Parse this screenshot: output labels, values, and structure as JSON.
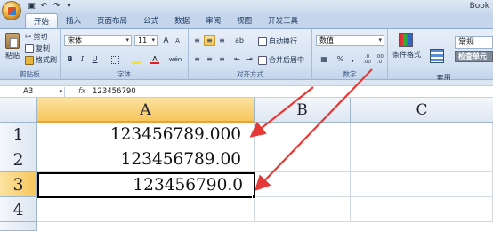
{
  "title_bar": {
    "title": "Book",
    "qat_icons": [
      "save-icon",
      "undo-icon",
      "redo-icon",
      "customize-icon"
    ]
  },
  "tabs": [
    {
      "label": "开始",
      "active": true
    },
    {
      "label": "插入"
    },
    {
      "label": "页面布局"
    },
    {
      "label": "公式"
    },
    {
      "label": "数据"
    },
    {
      "label": "审阅"
    },
    {
      "label": "视图"
    },
    {
      "label": "开发工具"
    }
  ],
  "clipboard": {
    "paste": "粘贴",
    "cut": "剪切",
    "copy": "复制",
    "format_painter": "格式刷",
    "label": "剪贴板"
  },
  "font": {
    "name": "宋体",
    "size": "11",
    "label": "字体",
    "bold": "B",
    "italic": "I",
    "underline": "U",
    "grow": "A",
    "shrink": "A",
    "color_letter": "A",
    "phonetic": "wén",
    "font_color": "#e02020",
    "fill_color": "#f5e23a"
  },
  "alignment": {
    "wrap": "自动换行",
    "merge": "合并后居中",
    "label": "对齐方式"
  },
  "number": {
    "format": "数值",
    "percent": "%",
    "comma": ",",
    "inc_decimal": ".0\n.00",
    "dec_decimal": ".00\n.0",
    "label": "数字"
  },
  "styles": {
    "conditional": "条件格式",
    "table": "套用\n表格格式",
    "style_name": "常规",
    "check_cell": "检查单元"
  },
  "formula_bar": {
    "name_box": "A3",
    "fx": "fx",
    "value": "123456790"
  },
  "columns": [
    "A",
    "B",
    "C"
  ],
  "rows": [
    "1",
    "2",
    "3",
    "4"
  ],
  "cells": {
    "A1": "123456789.000",
    "A2": "123456789.00",
    "A3": "123456790.0"
  },
  "annotation_color": "#e53935"
}
